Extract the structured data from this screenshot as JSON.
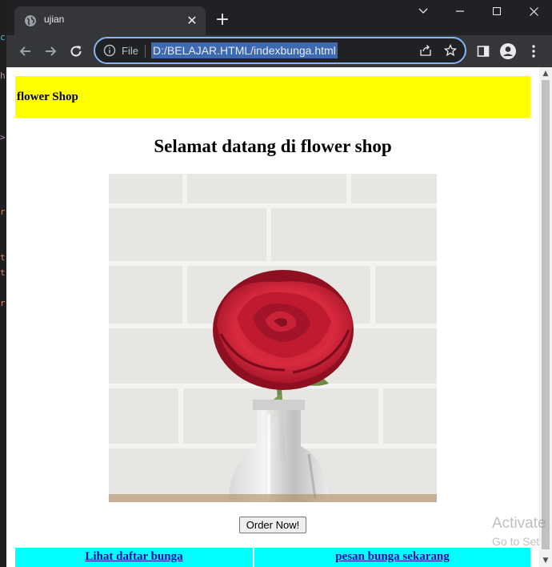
{
  "browser": {
    "tab_title": "ujian",
    "omnibox": {
      "scheme_label": "File",
      "url": "D:/BELAJAR.HTML/indexbunga.html"
    }
  },
  "page": {
    "header_title": "flower Shop",
    "welcome_heading": "Selamat datang di flower shop",
    "order_button": "Order Now!",
    "nav_links": [
      {
        "label": "Lihat daftar bunga"
      },
      {
        "label": "pesan bunga sekarang"
      }
    ]
  },
  "windows_watermark": {
    "line1": "Activate",
    "line2": "Go to Set"
  },
  "colors": {
    "header_bg": "#ffff00",
    "nav_bg": "#00ffff",
    "link": "#1a0dab",
    "omnibox_focus": "#8ab4f8"
  },
  "icons": [
    "globe-icon",
    "close-icon",
    "plus-icon",
    "chevron-down-icon",
    "minimize-icon",
    "maximize-icon",
    "back-arrow-icon",
    "forward-arrow-icon",
    "reload-icon",
    "info-icon",
    "share-icon",
    "star-icon",
    "side-panel-icon",
    "profile-icon",
    "kebab-menu-icon"
  ]
}
